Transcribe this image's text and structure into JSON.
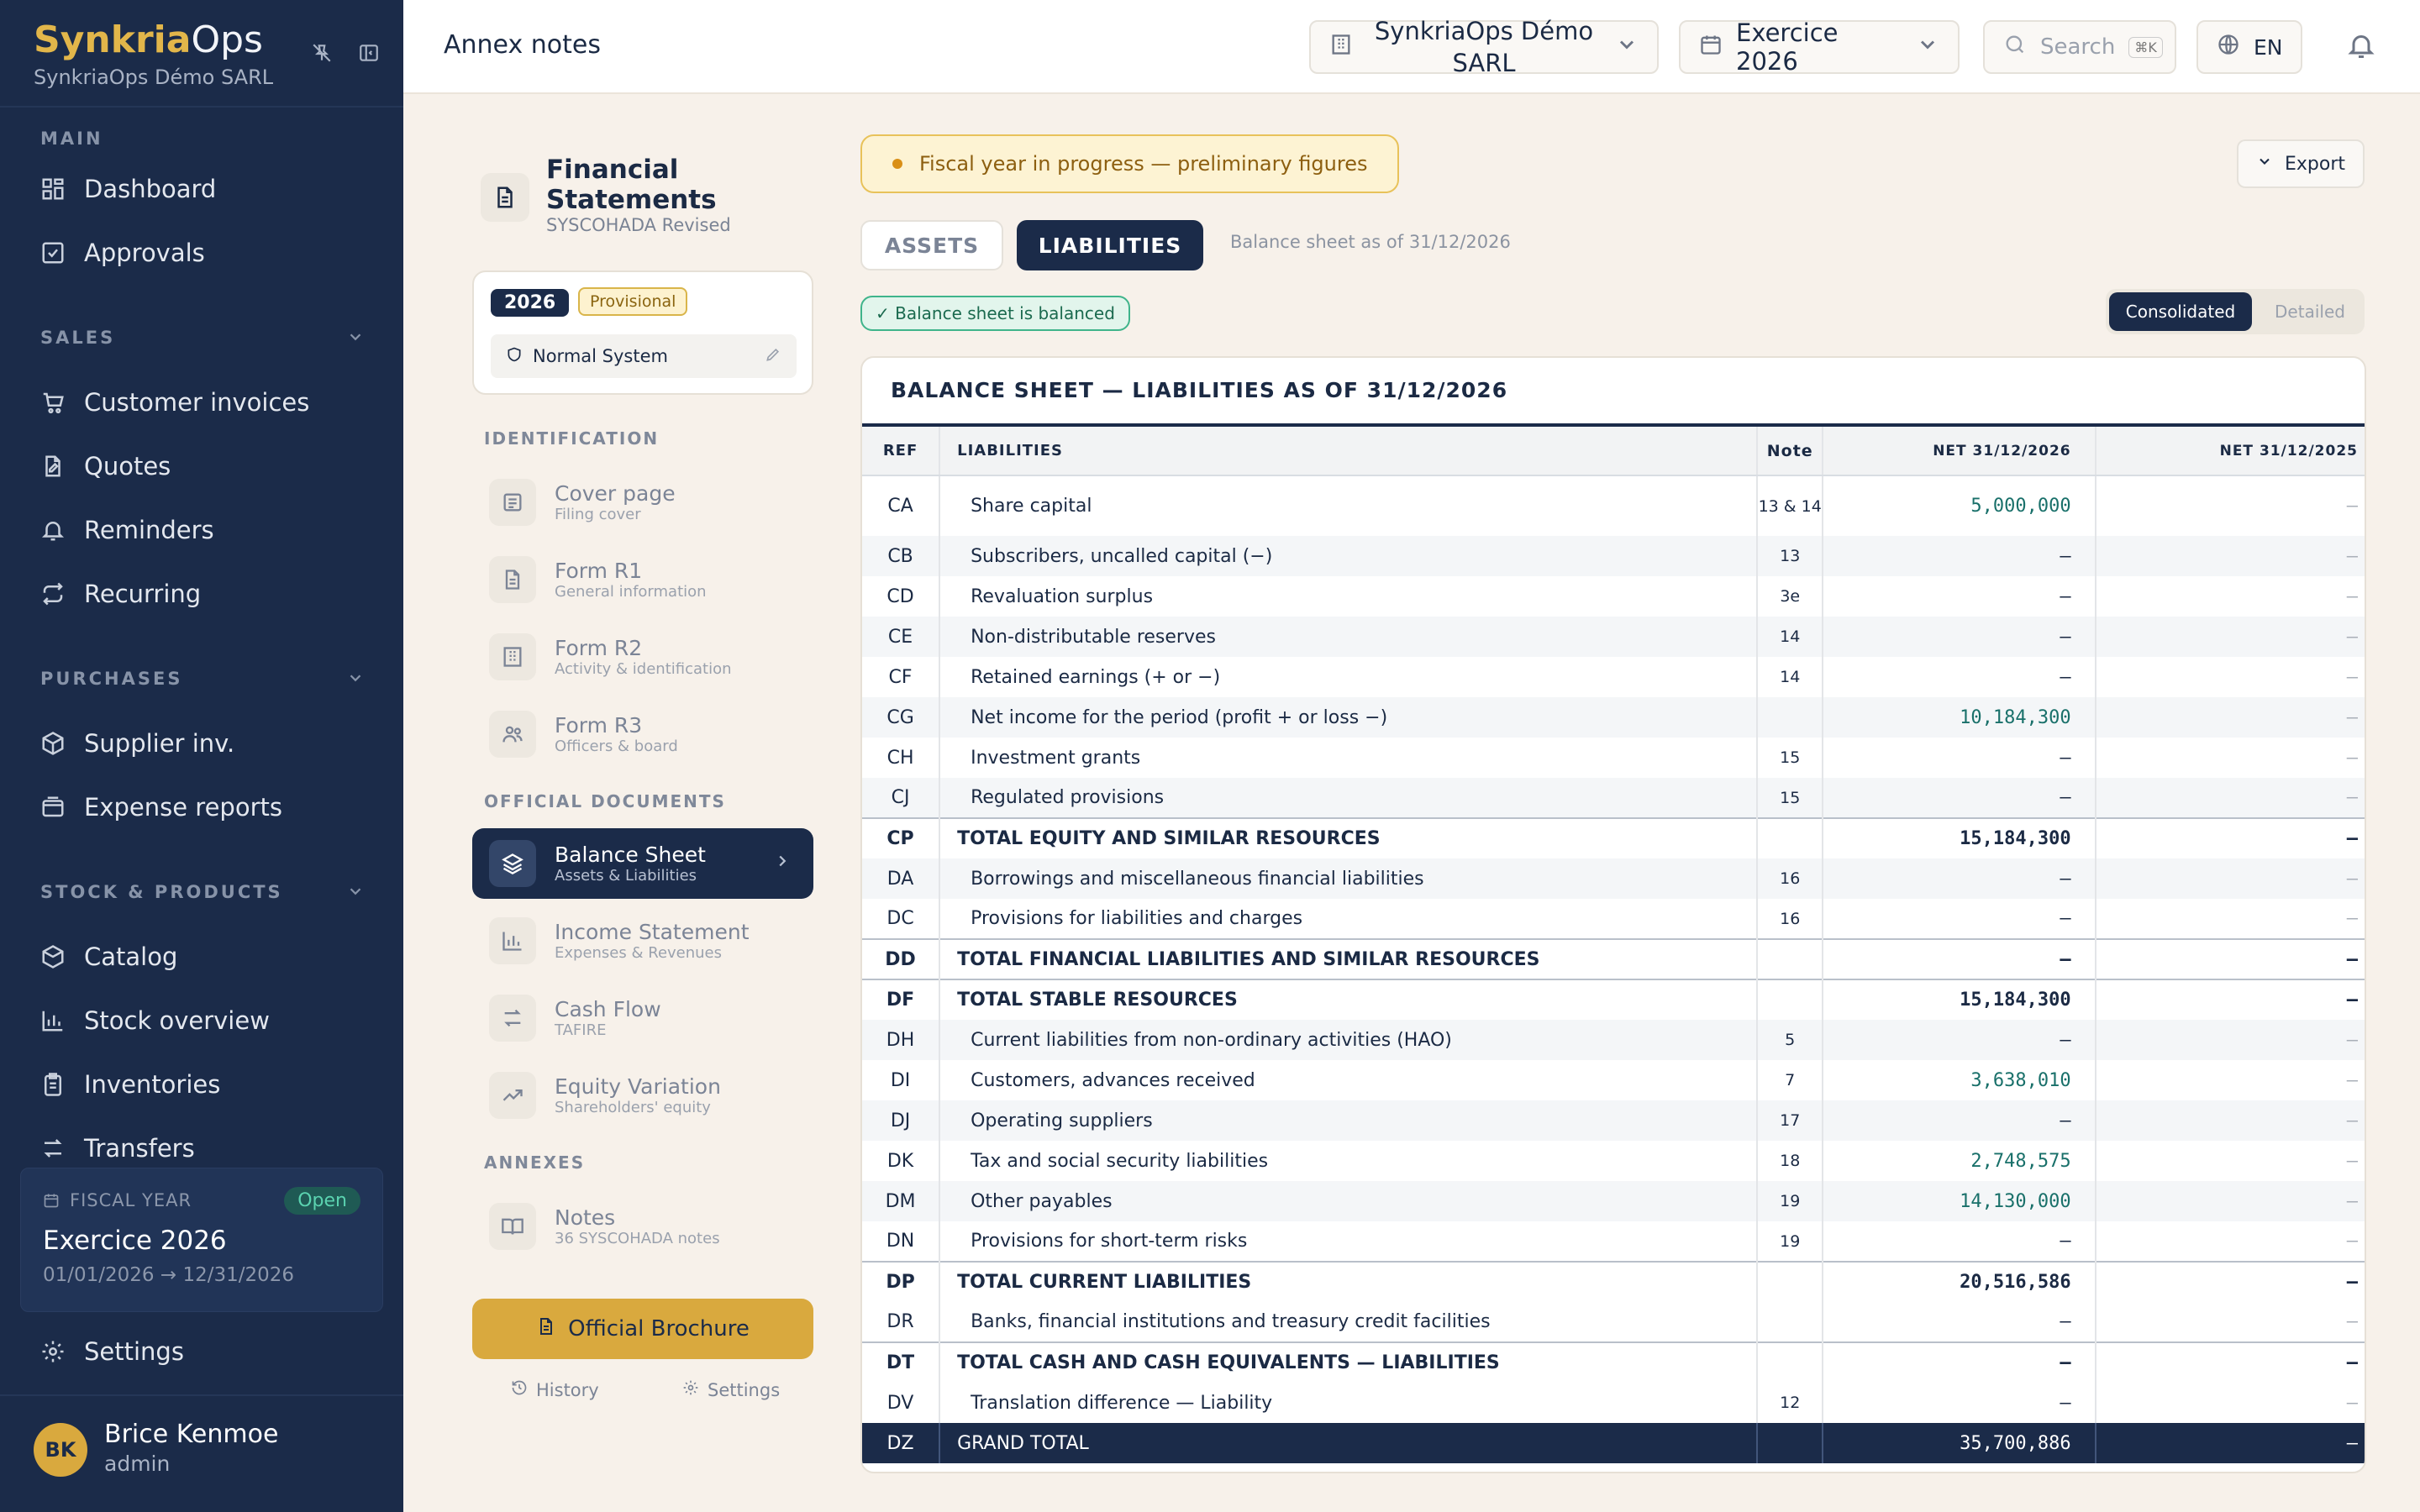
{
  "sidebar": {
    "brand_a": "Synkria",
    "brand_b": "Ops",
    "company": "SynkriaOps Démo SARL",
    "sections": {
      "main": "MAIN",
      "sales": "SALES",
      "purchases": "PURCHASES",
      "stock": "STOCK & PRODUCTS"
    },
    "items": {
      "dashboard": "Dashboard",
      "approvals": "Approvals",
      "customer_invoices": "Customer invoices",
      "quotes": "Quotes",
      "reminders": "Reminders",
      "recurring": "Recurring",
      "supplier_inv": "Supplier inv.",
      "expense_reports": "Expense reports",
      "catalog": "Catalog",
      "stock_overview": "Stock overview",
      "inventories": "Inventories",
      "transfers": "Transfers",
      "settings": "Settings"
    },
    "fiscal": {
      "label": "FISCAL YEAR",
      "status": "Open",
      "title": "Exercice 2026",
      "dates": "01/01/2026 → 12/31/2026"
    },
    "user": {
      "initials": "BK",
      "name": "Brice Kenmoe",
      "role": "admin"
    }
  },
  "header": {
    "title": "Annex notes",
    "company_line1": "SynkriaOps Démo",
    "company_line2": "SARL",
    "exercise": "Exercice 2026",
    "search_placeholder": "Search",
    "search_kbd": "⌘K",
    "lang": "EN"
  },
  "statements": {
    "title": "Financial Statements",
    "subtitle": "SYSCOHADA Revised",
    "year": "2026",
    "badge": "Provisional",
    "system": "Normal System",
    "sec_identification": "IDENTIFICATION",
    "sec_official": "OFFICIAL DOCUMENTS",
    "sec_annexes": "ANNEXES",
    "docs": {
      "cover": {
        "a": "Cover page",
        "b": "Filing cover"
      },
      "r1": {
        "a": "Form R1",
        "b": "General information"
      },
      "r2": {
        "a": "Form R2",
        "b": "Activity & identification"
      },
      "r3": {
        "a": "Form R3",
        "b": "Officers & board"
      },
      "balance": {
        "a": "Balance Sheet",
        "b": "Assets & Liabilities"
      },
      "income": {
        "a": "Income Statement",
        "b": "Expenses & Revenues"
      },
      "cash": {
        "a": "Cash Flow",
        "b": "TAFIRE"
      },
      "equity": {
        "a": "Equity Variation",
        "b": "Shareholders' equity"
      },
      "notes": {
        "a": "Notes",
        "b": "36 SYSCOHADA notes"
      }
    },
    "brochure": "Official Brochure",
    "history": "History",
    "settings": "Settings"
  },
  "main": {
    "banner": "Fiscal year in progress — preliminary figures",
    "export": "Export",
    "tab_assets": "ASSETS",
    "tab_liabilities": "LIABILITIES",
    "as_of": "Balance sheet as of 31/12/2026",
    "balanced": "✓ Balance sheet is balanced",
    "view_consolidated": "Consolidated",
    "view_detailed": "Detailed",
    "table_title": "BALANCE SHEET — LIABILITIES AS OF 31/12/2026",
    "columns": {
      "ref": "REF",
      "label": "LIABILITIES",
      "note": "Note",
      "v1": "NET 31/12/2026",
      "v2": "NET 31/12/2025"
    },
    "rows": [
      {
        "ref": "CA",
        "label": "Share capital",
        "note": "13 & 14",
        "v1": "5,000,000",
        "v2": "–"
      },
      {
        "ref": "CB",
        "label": "Subscribers, uncalled capital (−)",
        "note": "13",
        "v1": "–",
        "v2": "–"
      },
      {
        "ref": "CD",
        "label": "Revaluation surplus",
        "note": "3e",
        "v1": "–",
        "v2": "–"
      },
      {
        "ref": "CE",
        "label": "Non-distributable reserves",
        "note": "14",
        "v1": "–",
        "v2": "–"
      },
      {
        "ref": "CF",
        "label": "Retained earnings (+ or −)",
        "note": "14",
        "v1": "–",
        "v2": "–"
      },
      {
        "ref": "CG",
        "label": "Net income for the period (profit + or loss −)",
        "note": "",
        "v1": "10,184,300",
        "v2": "–"
      },
      {
        "ref": "CH",
        "label": "Investment grants",
        "note": "15",
        "v1": "–",
        "v2": "–"
      },
      {
        "ref": "CJ",
        "label": "Regulated provisions",
        "note": "15",
        "v1": "–",
        "v2": "–"
      },
      {
        "ref": "CP",
        "label": "TOTAL EQUITY AND SIMILAR RESOURCES",
        "note": "",
        "v1": "15,184,300",
        "v2": "–"
      },
      {
        "ref": "DA",
        "label": "Borrowings and miscellaneous financial liabilities",
        "note": "16",
        "v1": "–",
        "v2": "–"
      },
      {
        "ref": "DC",
        "label": "Provisions for liabilities and charges",
        "note": "16",
        "v1": "–",
        "v2": "–"
      },
      {
        "ref": "DD",
        "label": "TOTAL FINANCIAL LIABILITIES AND SIMILAR RESOURCES",
        "note": "",
        "v1": "–",
        "v2": "–"
      },
      {
        "ref": "DF",
        "label": "TOTAL STABLE RESOURCES",
        "note": "",
        "v1": "15,184,300",
        "v2": "–"
      },
      {
        "ref": "DH",
        "label": "Current liabilities from non-ordinary activities (HAO)",
        "note": "5",
        "v1": "–",
        "v2": "–"
      },
      {
        "ref": "DI",
        "label": "Customers, advances received",
        "note": "7",
        "v1": "3,638,010",
        "v2": "–"
      },
      {
        "ref": "DJ",
        "label": "Operating suppliers",
        "note": "17",
        "v1": "–",
        "v2": "–"
      },
      {
        "ref": "DK",
        "label": "Tax and social security liabilities",
        "note": "18",
        "v1": "2,748,575",
        "v2": "–"
      },
      {
        "ref": "DM",
        "label": "Other payables",
        "note": "19",
        "v1": "14,130,000",
        "v2": "–"
      },
      {
        "ref": "DN",
        "label": "Provisions for short-term risks",
        "note": "19",
        "v1": "–",
        "v2": "–"
      },
      {
        "ref": "DP",
        "label": "TOTAL CURRENT LIABILITIES",
        "note": "",
        "v1": "20,516,586",
        "v2": "–"
      },
      {
        "ref": "DR",
        "label": "Banks, financial institutions and treasury credit facilities",
        "note": "",
        "v1": "–",
        "v2": "–"
      },
      {
        "ref": "DT",
        "label": "TOTAL CASH AND CASH EQUIVALENTS — LIABILITIES",
        "note": "",
        "v1": "–",
        "v2": "–"
      },
      {
        "ref": "DV",
        "label": "Translation difference — Liability",
        "note": "12",
        "v1": "–",
        "v2": "–"
      },
      {
        "ref": "DZ",
        "label": "GRAND TOTAL",
        "note": "",
        "v1": "35,700,886",
        "v2": "–"
      }
    ]
  }
}
